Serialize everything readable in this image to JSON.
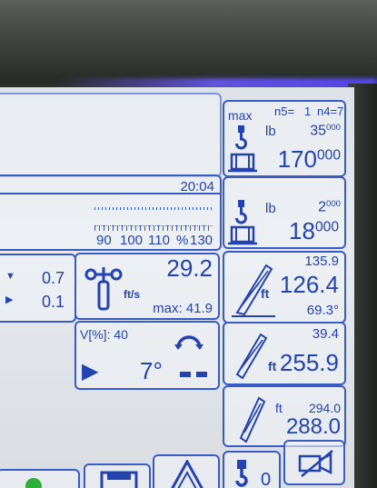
{
  "load_panel": {
    "max_label": "max",
    "n5_label": "n5=",
    "n5_value": "1",
    "n4_label": "n4=",
    "n4_value": "7",
    "unit": "lb",
    "max_load_main": "35",
    "max_load_sup": "000",
    "load_main": "170",
    "load_sup": "000"
  },
  "time_panel": {
    "time": "20:04",
    "scale_labels": [
      "90",
      "100",
      "110",
      "%",
      "130"
    ]
  },
  "hook_panel": {
    "unit": "lb",
    "top_main": "2",
    "top_sup": "000",
    "big_main": "18",
    "big_sup": "000"
  },
  "left_values": {
    "upper": "0.7",
    "lower": "0.1"
  },
  "wind_panel": {
    "speed": "29.2",
    "unit": "ft/s",
    "max_label": "max: 41.9"
  },
  "slew_panel": {
    "v_label": "V[%]: 40",
    "angle": "7°"
  },
  "boom_panel": {
    "length_top": "135.9",
    "unit": "ft",
    "radius": "126.4",
    "angle": "69.3°"
  },
  "jib_panel": {
    "top_value": "39.4",
    "unit": "ft",
    "value": "255.9"
  },
  "height_panel": {
    "unit": "ft",
    "top_value": "294.0",
    "value": "288.0"
  },
  "bottom_bar": {
    "hook_count": "0"
  }
}
